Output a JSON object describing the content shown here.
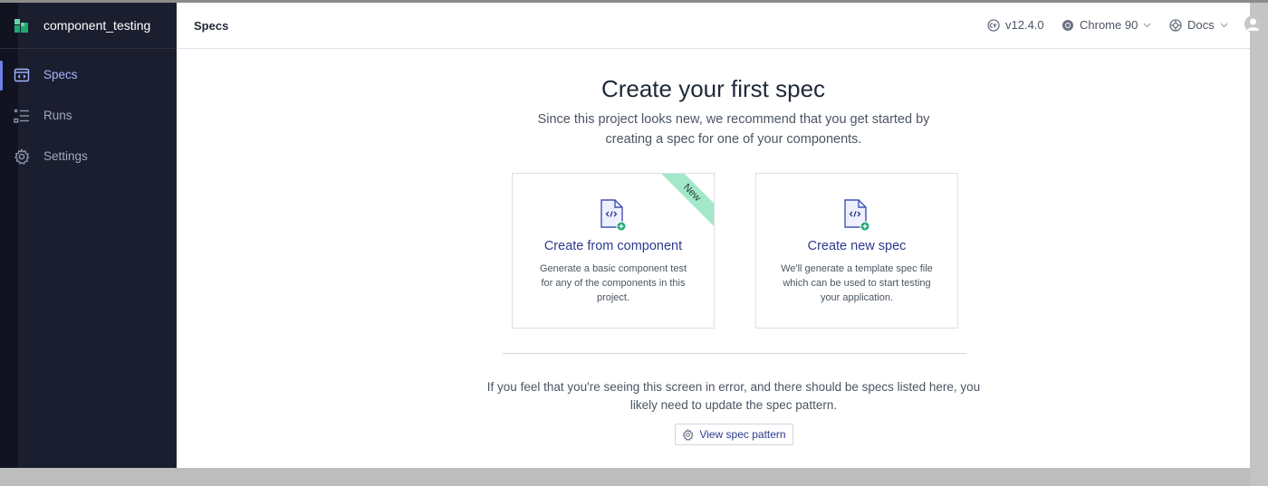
{
  "app": {
    "project_name": "component_testing"
  },
  "sidebar": {
    "items": [
      {
        "label": "Specs",
        "icon": "specs-icon",
        "active": true
      },
      {
        "label": "Runs",
        "icon": "runs-icon",
        "active": false
      },
      {
        "label": "Settings",
        "icon": "gear-icon",
        "active": false
      }
    ]
  },
  "header": {
    "breadcrumb": "Specs",
    "version": "v12.4.0",
    "browser": "Chrome 90",
    "docs": "Docs"
  },
  "main": {
    "heading": "Create your first spec",
    "subheading": "Since this project looks new, we recommend that you get started by creating a spec for one of your components.",
    "cards": [
      {
        "title": "Create from component",
        "description": "Generate a basic component test for any of the components in this project.",
        "badge": "New"
      },
      {
        "title": "Create new spec",
        "description": "We'll generate a template spec file which can be used to start testing your application."
      }
    ],
    "error_text": "If you feel that you're seeing this screen in error, and there should be specs listed here, you likely need to update the spec pattern.",
    "view_pattern_label": "View spec pattern"
  },
  "colors": {
    "sidebar_bg": "#1b1e2e",
    "accent": "#2e3a8c",
    "active_nav": "#a3b5ff",
    "badge_green": "#a3e8c8"
  }
}
